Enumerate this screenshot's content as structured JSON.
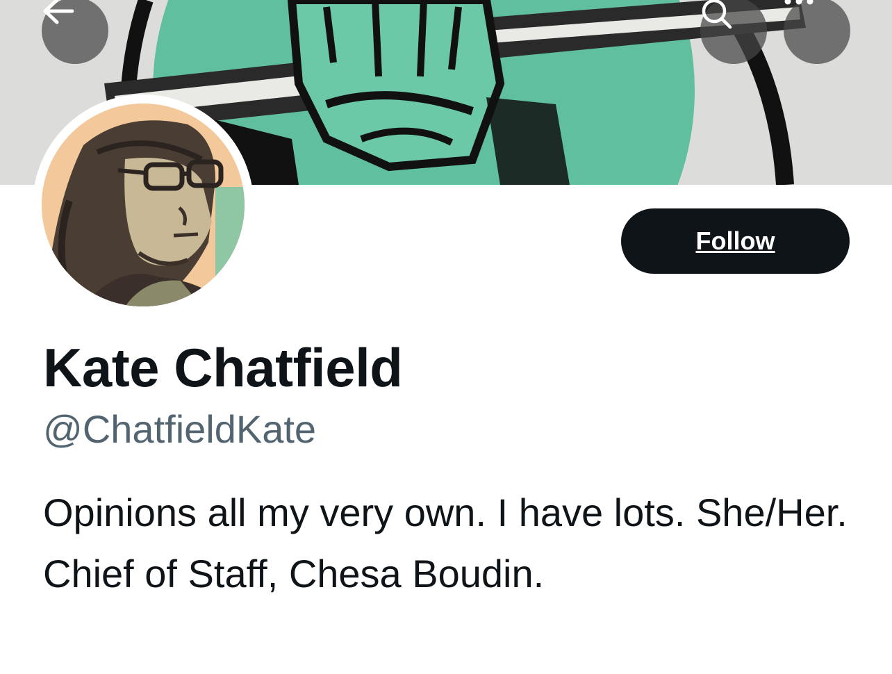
{
  "header": {
    "back_icon": "arrow-left-icon",
    "search_icon": "search-icon",
    "more_icon": "more-horizontal-icon"
  },
  "profile": {
    "display_name": "Kate Chatfield",
    "handle": "@ChatfieldKate",
    "bio": "Opinions all my very own. I have lots. She/Her. Chief of Staff, Chesa Boudin."
  },
  "actions": {
    "follow_label": "Follow"
  },
  "colors": {
    "banner_green": "#5fbf9f",
    "ink": "#0f1419",
    "secondary_text": "#536471",
    "follow_button_bg": "#0f1419"
  }
}
